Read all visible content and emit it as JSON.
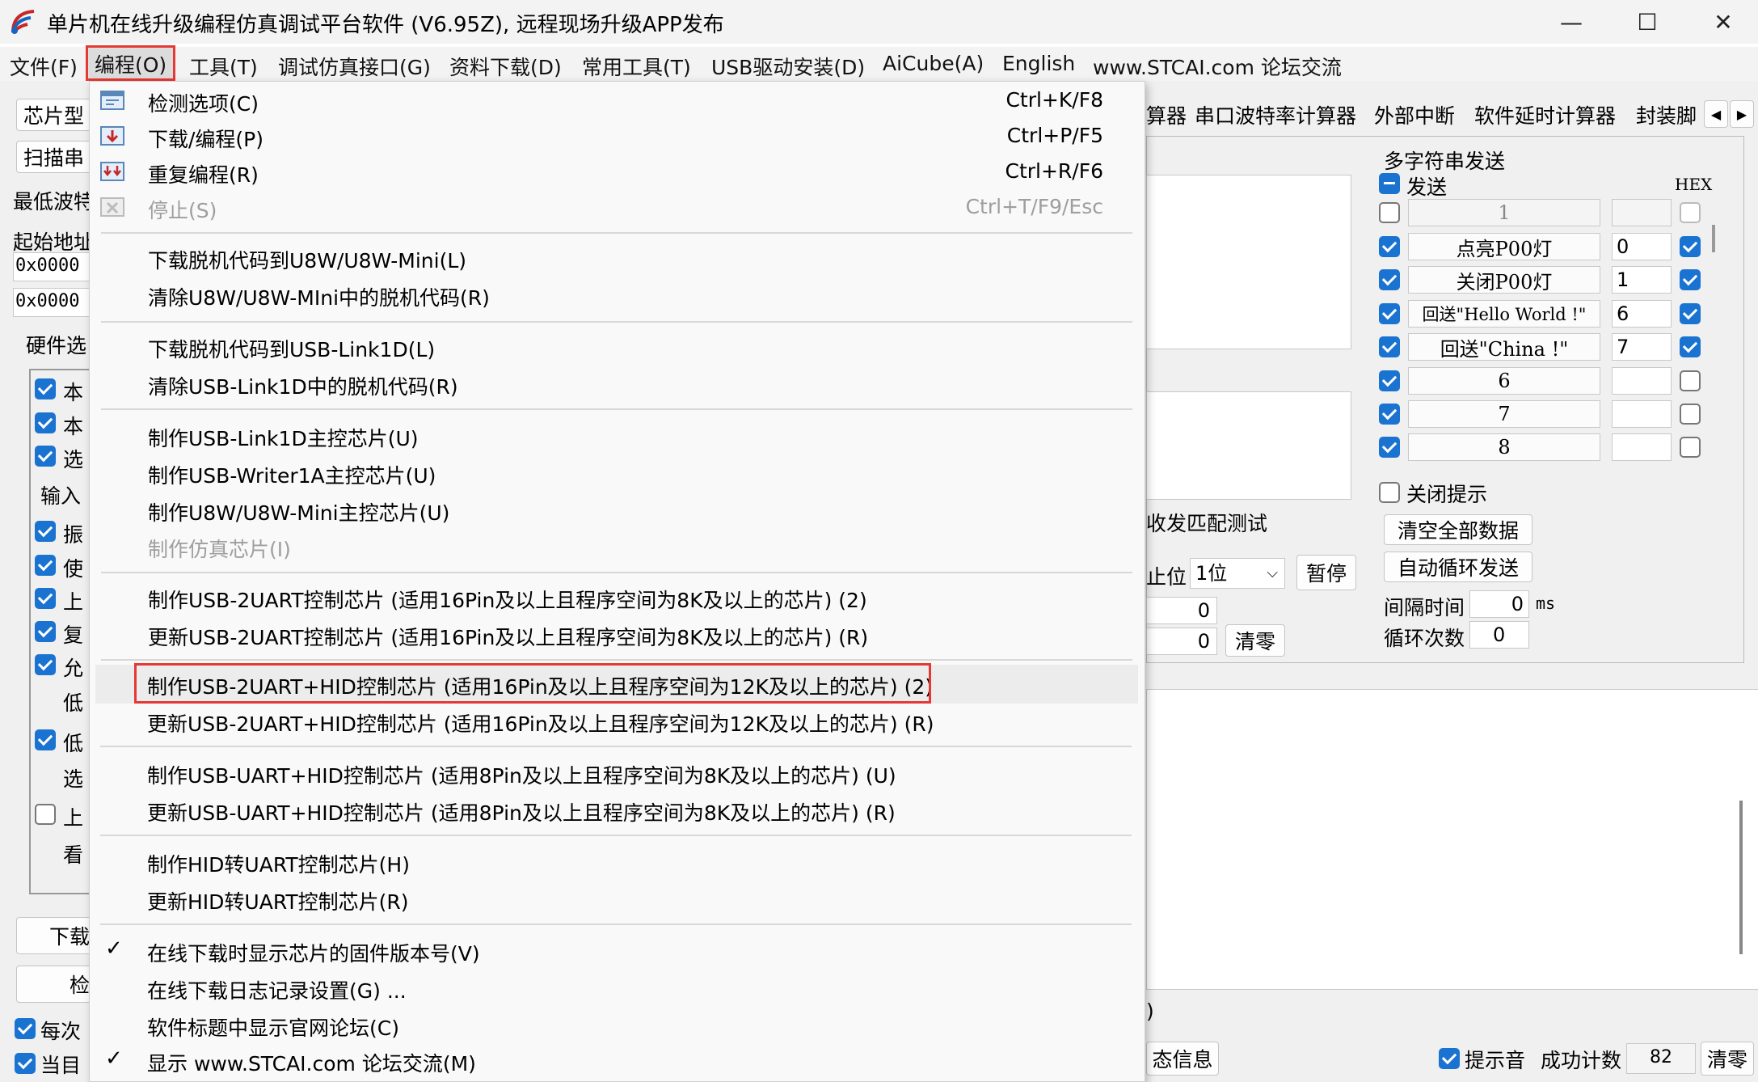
{
  "window": {
    "title": "单片机在线升级编程仿真调试平台软件 (V6.95Z), 远程现场升级APP发布",
    "controls": {
      "minimize": "—",
      "maximize": "☐",
      "close": "✕"
    }
  },
  "menubar": [
    "文件(F)",
    "编程(O)",
    "工具(T)",
    "调试仿真接口(G)",
    "资料下载(D)",
    "常用工具(T)",
    "USB驱动安装(D)",
    "AiCube(A)",
    "English",
    "www.STCAI.com 论坛交流"
  ],
  "dropdown": {
    "items": [
      {
        "label": "检测选项(C)",
        "shortcut": "Ctrl+K/F8",
        "icon": "detect-icon"
      },
      {
        "label": "下载/编程(P)",
        "shortcut": "Ctrl+P/F5",
        "icon": "download-icon"
      },
      {
        "label": "重复编程(R)",
        "shortcut": "Ctrl+R/F6",
        "icon": "repeat-program-icon"
      },
      {
        "label": "停止(S)",
        "shortcut": "Ctrl+T/F9/Esc",
        "icon": "stop-icon",
        "disabled": true
      },
      {
        "label": "下载脱机代码到U8W/U8W-Mini(L)"
      },
      {
        "label": "清除U8W/U8W-MIni中的脱机代码(R)"
      },
      {
        "label": "下载脱机代码到USB-Link1D(L)"
      },
      {
        "label": "清除USB-Link1D中的脱机代码(R)"
      },
      {
        "label": "制作USB-Link1D主控芯片(U)"
      },
      {
        "label": "制作USB-Writer1A主控芯片(U)"
      },
      {
        "label": "制作U8W/U8W-Mini主控芯片(U)"
      },
      {
        "label": "制作仿真芯片(I)",
        "disabled": true
      },
      {
        "label": "制作USB-2UART控制芯片 (适用16Pin及以上且程序空间为8K及以上的芯片) (2)"
      },
      {
        "label": "更新USB-2UART控制芯片 (适用16Pin及以上且程序空间为8K及以上的芯片) (R)"
      },
      {
        "label": "制作USB-2UART+HID控制芯片 (适用16Pin及以上且程序空间为12K及以上的芯片) (2)"
      },
      {
        "label": "更新USB-2UART+HID控制芯片 (适用16Pin及以上且程序空间为12K及以上的芯片) (R)"
      },
      {
        "label": "制作USB-UART+HID控制芯片 (适用8Pin及以上且程序空间为8K及以上的芯片) (U)"
      },
      {
        "label": "更新USB-UART+HID控制芯片 (适用8Pin及以上且程序空间为8K及以上的芯片) (R)"
      },
      {
        "label": "制作HID转UART控制芯片(H)"
      },
      {
        "label": "更新HID转UART控制芯片(R)"
      },
      {
        "label": "在线下载时显示芯片的固件版本号(V)",
        "checked": true
      },
      {
        "label": "在线下载日志记录设置(G) ..."
      },
      {
        "label": "软件标题中显示官网论坛(C)"
      },
      {
        "label": "显示 www.STCAI.com 论坛交流(M)",
        "checked": true
      }
    ]
  },
  "left_panel": {
    "chip_type": "芯片型",
    "scan_btn": "扫描串",
    "min_baud": "最低波特",
    "start_addr": "起始地址",
    "addr1": "0x0000",
    "addr2": "0x0000",
    "hw_tab": "硬件选",
    "options": [
      {
        "text": "本",
        "checked": true
      },
      {
        "text": "本",
        "checked": true
      },
      {
        "text": "选",
        "checked": true
      },
      {
        "text": "输入",
        "checked": null
      },
      {
        "text": "振",
        "checked": true
      },
      {
        "text": "使",
        "checked": true
      },
      {
        "text": "上",
        "checked": true
      },
      {
        "text": "复",
        "checked": true
      },
      {
        "text": "允",
        "checked": true
      },
      {
        "text": "低",
        "checked": null
      },
      {
        "text": "低",
        "checked": true
      },
      {
        "text": "选",
        "checked": null
      },
      {
        "text": "上",
        "checked": false
      },
      {
        "text": "看",
        "checked": null
      }
    ],
    "download_btn": "下载",
    "check_btn": "检",
    "every_time": "每次",
    "current": "当目"
  },
  "right_panel": {
    "tabs": [
      "算器",
      "串口波特率计算器",
      "外部中断",
      "软件延时计算器",
      "封装脚"
    ],
    "multi_send_title": "多字符串发送",
    "send_label": "发送",
    "hex_label": "HEX",
    "rows": [
      {
        "enabled": false,
        "text": "1",
        "hex_value": "",
        "hex": false
      },
      {
        "enabled": true,
        "text": "点亮P00灯",
        "hex_value": "0",
        "hex": true
      },
      {
        "enabled": true,
        "text": "关闭P00灯",
        "hex_value": "1",
        "hex": true
      },
      {
        "enabled": true,
        "text": "回送\"Hello World !\"",
        "hex_value": "6",
        "hex": true
      },
      {
        "enabled": true,
        "text": "回送\"China !\"",
        "hex_value": "7",
        "hex": true
      },
      {
        "enabled": true,
        "text": "6",
        "hex_value": "",
        "hex": false
      },
      {
        "enabled": true,
        "text": "7",
        "hex_value": "",
        "hex": false
      },
      {
        "enabled": true,
        "text": "8",
        "hex_value": "",
        "hex": false
      }
    ],
    "close_hint": "关闭提示",
    "clear_all": "清空全部数据",
    "auto_loop": "自动循环发送",
    "interval_label": "间隔时间",
    "interval_value": "0",
    "interval_unit": "ms",
    "loop_label": "循环次数",
    "loop_value": "0",
    "match_test": "收发匹配测试",
    "stop_bit_label": "止位",
    "stop_bit_value": "1位",
    "pause_btn": "暂停",
    "count1": "0",
    "count2": "0",
    "clear_btn": "清零",
    "paren": ")",
    "status_info": "态信息",
    "beep_label": "提示音",
    "success_label": "成功计数",
    "success_value": "82",
    "clear_btn2": "清零"
  }
}
